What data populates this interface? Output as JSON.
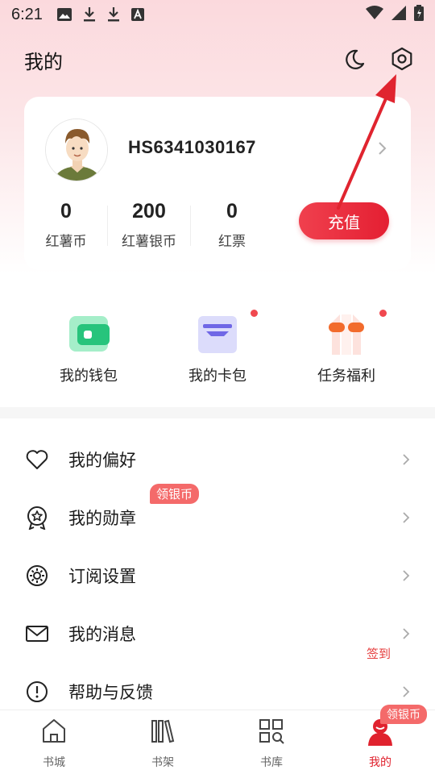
{
  "status_bar": {
    "time": "6:21"
  },
  "header": {
    "title": "我的"
  },
  "profile": {
    "username": "HS6341030167",
    "stats": [
      {
        "value": "0",
        "label": "红薯币"
      },
      {
        "value": "200",
        "label": "红薯银币"
      },
      {
        "value": "0",
        "label": "红票"
      }
    ],
    "recharge_label": "充值"
  },
  "quick_actions": [
    {
      "label": "我的钱包",
      "icon": "wallet-icon"
    },
    {
      "label": "我的卡包",
      "icon": "card-wallet-icon"
    },
    {
      "label": "任务福利",
      "icon": "gift-icon"
    }
  ],
  "menu": [
    {
      "label": "我的偏好",
      "icon": "heart-icon"
    },
    {
      "label": "我的勋章",
      "icon": "medal-icon",
      "badge": "领银币"
    },
    {
      "label": "订阅设置",
      "icon": "gear-icon"
    },
    {
      "label": "我的消息",
      "icon": "mail-icon"
    },
    {
      "label": "帮助与反馈",
      "icon": "help-icon"
    }
  ],
  "floating": {
    "checkin_label": "签到",
    "tab_badge": "领银币"
  },
  "tabbar": [
    {
      "label": "书城",
      "icon": "home-icon",
      "active": false
    },
    {
      "label": "书架",
      "icon": "bookshelf-icon",
      "active": false
    },
    {
      "label": "书库",
      "icon": "library-icon",
      "active": false
    },
    {
      "label": "我的",
      "icon": "profile-icon",
      "active": true
    }
  ],
  "colors": {
    "accent": "#e41f32",
    "badge": "#f46a6a",
    "annotation_arrow": "#e0242f"
  }
}
